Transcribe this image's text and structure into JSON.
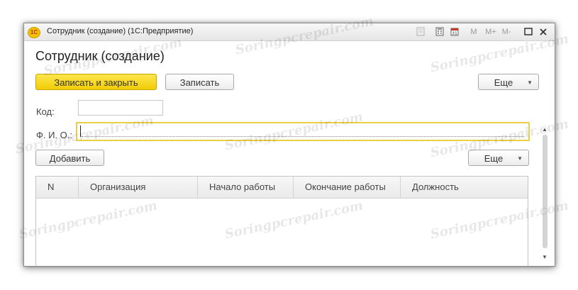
{
  "window": {
    "title": "Сотрудник (создание)  (1С:Предприятие)",
    "app_icon_text": "1С",
    "buttons": [
      "M",
      "M+",
      "M-"
    ]
  },
  "form": {
    "title": "Сотрудник (создание)",
    "toolbar": {
      "save_and_close": "Записать и закрыть",
      "save": "Записать",
      "more": "Еще"
    },
    "fields": {
      "code_label": "Код:",
      "code_value": "",
      "fio_label": "Ф. И. О.:",
      "fio_value": ""
    },
    "table_toolbar": {
      "add": "Добавить",
      "more": "Еще"
    },
    "table": {
      "columns": [
        "N",
        "Организация",
        "Начало работы",
        "Окончание работы",
        "Должность"
      ],
      "rows": []
    }
  },
  "watermark": "Soringpcrepair.com",
  "colors": {
    "primary_button": "#f5d20c",
    "focus_border": "#eccf42"
  }
}
